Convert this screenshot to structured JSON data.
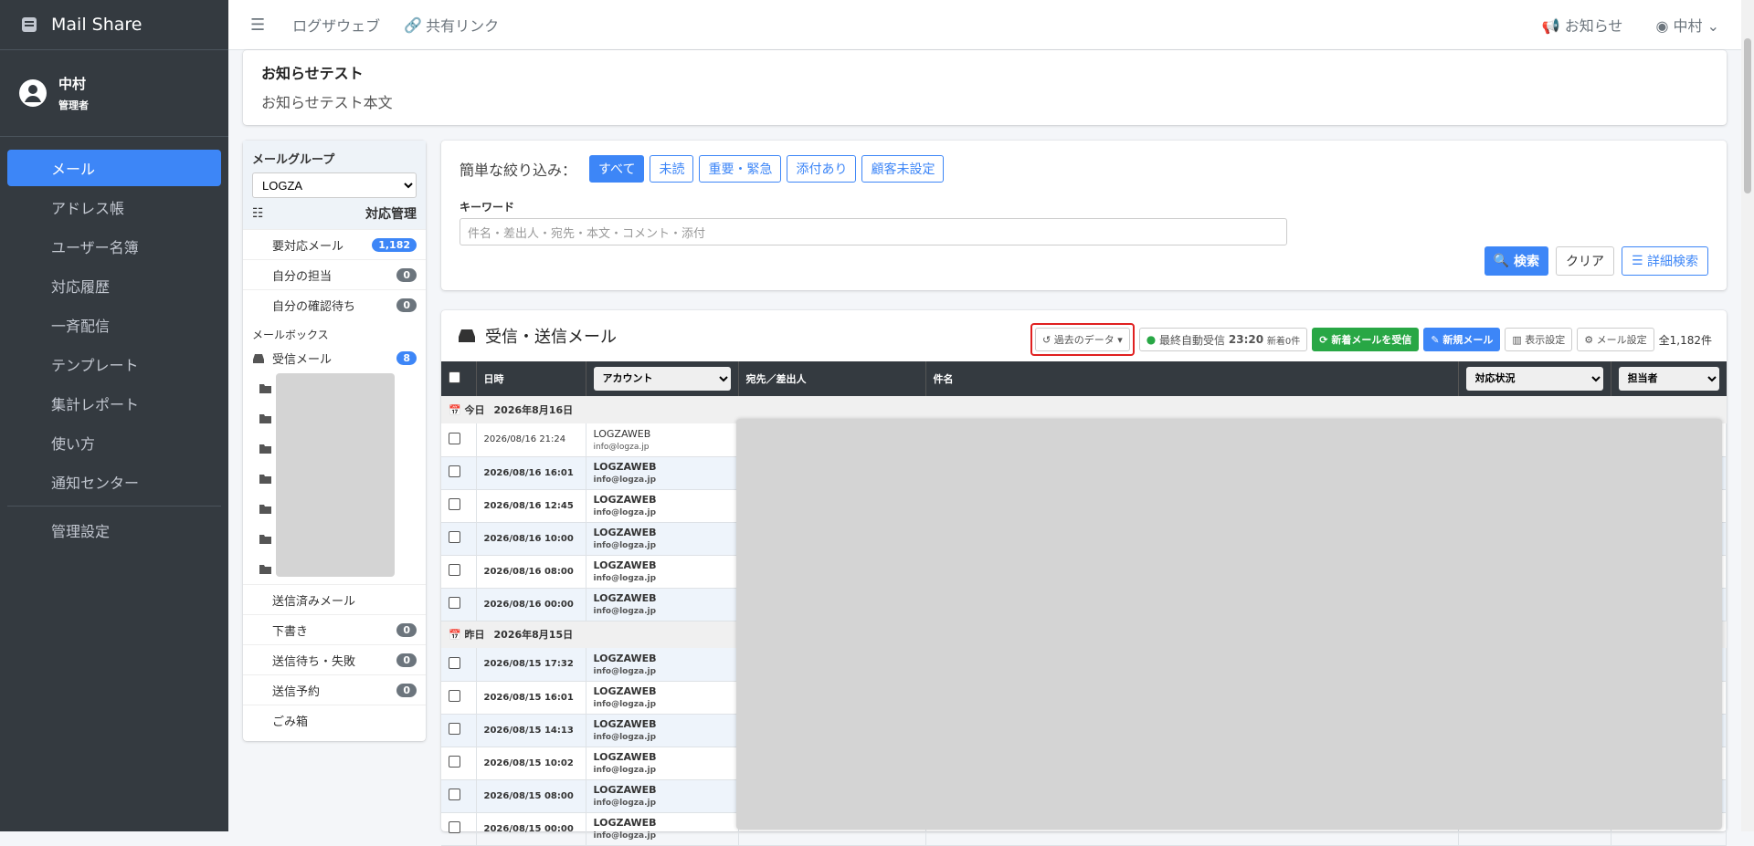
{
  "brand": "Mail Share",
  "user": {
    "name": "中村",
    "role": "管理者"
  },
  "nav": [
    {
      "label": "メール",
      "icon": "inbox-icon"
    },
    {
      "label": "アドレス帳",
      "icon": "address-book-icon"
    },
    {
      "label": "ユーザー名簿",
      "icon": "id-card-icon"
    },
    {
      "label": "対応履歴",
      "icon": "headset-icon"
    },
    {
      "label": "一斉配信",
      "icon": "paper-plane-icon"
    },
    {
      "label": "テンプレート",
      "icon": "file-icon"
    },
    {
      "label": "集計レポート",
      "icon": "chart-icon"
    },
    {
      "label": "使い方",
      "icon": "question-icon"
    },
    {
      "label": "通知センター",
      "icon": "bell-icon"
    },
    {
      "label": "管理設定",
      "icon": "sliders-icon"
    }
  ],
  "topbar": {
    "menu_icon": "hamburger-icon",
    "link1": "ログザウェブ",
    "link2": "共有リンク",
    "notice": "お知らせ",
    "user": "中村"
  },
  "notice": {
    "title": "お知らせテスト",
    "body": "お知らせテスト本文"
  },
  "left": {
    "group_label": "メールグループ",
    "group_value": "LOGZA",
    "manage": "対応管理",
    "rows1": [
      {
        "label": "要対応メール",
        "count": "1,182",
        "blue": true
      },
      {
        "label": "自分の担当",
        "count": "0"
      },
      {
        "label": "自分の確認待ち",
        "count": "0"
      }
    ],
    "mailbox": "メールボックス",
    "inbox": "受信メール",
    "inbox_count": "8",
    "rows2": [
      {
        "label": "送信済みメール",
        "count": ""
      },
      {
        "label": "下書き",
        "count": "0"
      },
      {
        "label": "送信待ち・失敗",
        "count": "0"
      },
      {
        "label": "送信予約",
        "count": "0"
      },
      {
        "label": "ごみ箱",
        "count": ""
      }
    ]
  },
  "filter": {
    "label": "簡単な絞り込み：",
    "buttons": [
      "すべて",
      "未読",
      "重要・緊急",
      "添付あり",
      "顧客未設定"
    ],
    "keyword_label": "キーワード",
    "keyword_placeholder": "件名・差出人・宛先・本文・コメント・添付",
    "search": "検索",
    "clear": "クリア",
    "detail": "詳細検索"
  },
  "mail": {
    "title": "受信・送信メール",
    "past": "過去のデータ",
    "last_recv_label": "最終自動受信",
    "last_recv_time": "23:20",
    "new_count": "新着0件",
    "recv_btn": "新着メールを受信",
    "new_btn": "新規メール",
    "display_btn": "表示設定",
    "mail_setting_btn": "メール設定",
    "total": "全1,182件",
    "headers": {
      "date": "日時",
      "account": "アカウント",
      "from": "宛先／差出人",
      "subject": "件名",
      "status": "対応状況",
      "assignee": "担当者"
    },
    "groups": [
      {
        "label": "今日",
        "date": "2026年8月16日",
        "rows": [
          {
            "dt": "2026/08/16 21:24",
            "acc": "LOGZAWEB",
            "addr": "info@logza.jp",
            "read": true
          },
          {
            "dt": "2026/08/16 16:01",
            "acc": "LOGZAWEB",
            "addr": "info@logza.jp"
          },
          {
            "dt": "2026/08/16 12:45",
            "acc": "LOGZAWEB",
            "addr": "info@logza.jp"
          },
          {
            "dt": "2026/08/16 10:00",
            "acc": "LOGZAWEB",
            "addr": "info@logza.jp"
          },
          {
            "dt": "2026/08/16 08:00",
            "acc": "LOGZAWEB",
            "addr": "info@logza.jp"
          },
          {
            "dt": "2026/08/16 00:00",
            "acc": "LOGZAWEB",
            "addr": "info@logza.jp"
          }
        ]
      },
      {
        "label": "昨日",
        "date": "2026年8月15日",
        "rows": [
          {
            "dt": "2026/08/15 17:32",
            "acc": "LOGZAWEB",
            "addr": "info@logza.jp"
          },
          {
            "dt": "2026/08/15 16:01",
            "acc": "LOGZAWEB",
            "addr": "info@logza.jp"
          },
          {
            "dt": "2026/08/15 14:13",
            "acc": "LOGZAWEB",
            "addr": "info@logza.jp"
          },
          {
            "dt": "2026/08/15 10:02",
            "acc": "LOGZAWEB",
            "addr": "info@logza.jp"
          },
          {
            "dt": "2026/08/15 08:00",
            "acc": "LOGZAWEB",
            "addr": "info@logza.jp"
          },
          {
            "dt": "2026/08/15 00:00",
            "acc": "LOGZAWEB",
            "addr": "info@logza.jp"
          }
        ]
      }
    ]
  }
}
